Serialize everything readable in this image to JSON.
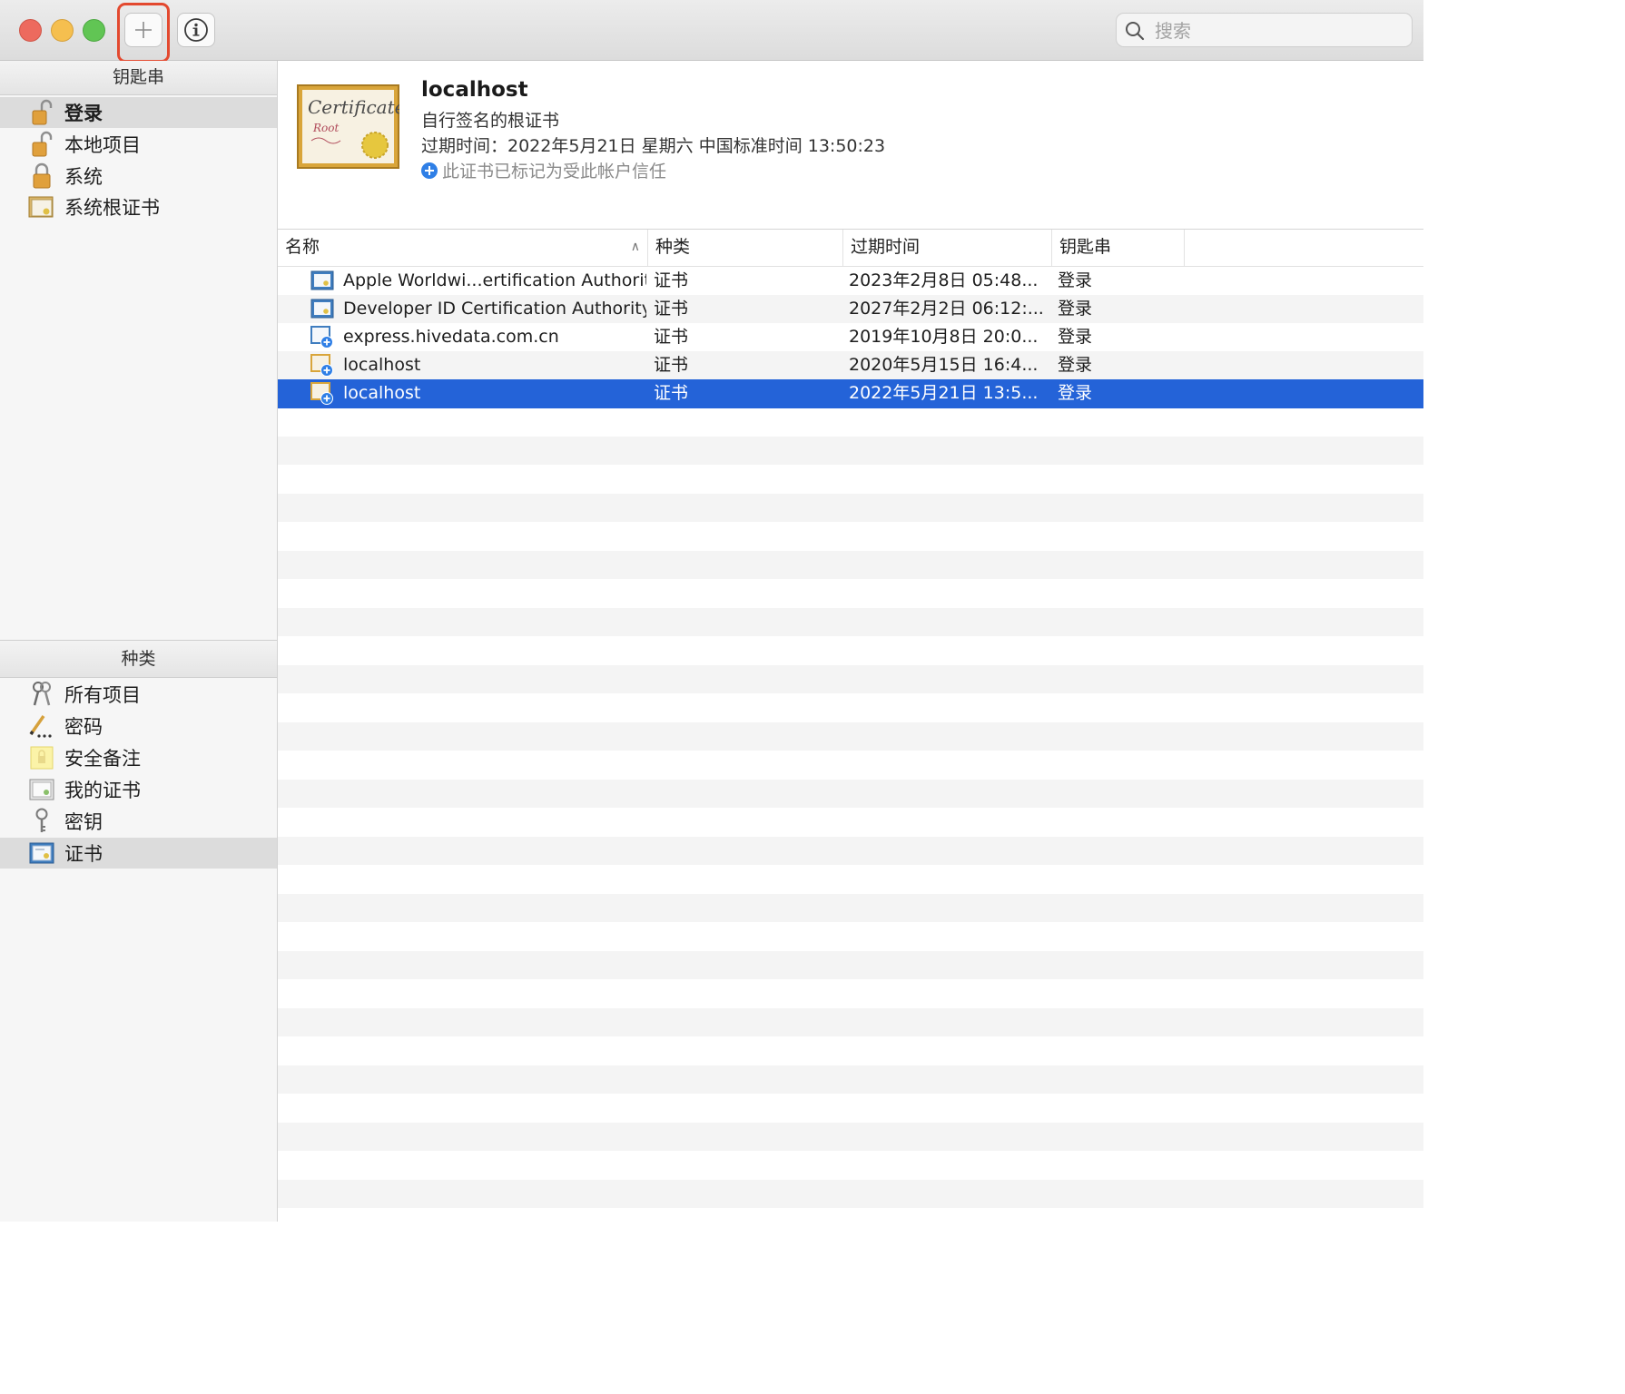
{
  "toolbar": {
    "search_placeholder": "搜索"
  },
  "sidebar": {
    "keychains_header": "钥匙串",
    "keychains": [
      {
        "label": "登录"
      },
      {
        "label": "本地项目"
      },
      {
        "label": "系统"
      },
      {
        "label": "系统根证书"
      }
    ],
    "category_header": "种类",
    "categories": [
      {
        "label": "所有项目"
      },
      {
        "label": "密码"
      },
      {
        "label": "安全备注"
      },
      {
        "label": "我的证书"
      },
      {
        "label": "密钥"
      },
      {
        "label": "证书"
      }
    ]
  },
  "detail": {
    "title": "localhost",
    "subtitle": "自行签名的根证书",
    "expires": "过期时间：2022年5月21日 星期六 中国标准时间 13:50:23",
    "trust": "此证书已标记为受此帐户信任"
  },
  "table": {
    "headers": {
      "name": "名称",
      "kind": "种类",
      "expires": "过期时间",
      "keychain": "钥匙串"
    },
    "rows": [
      {
        "name": "Apple Worldwi...ertification Authority",
        "kind": "证书",
        "expires": "2023年2月8日 05:48...",
        "keychain": "登录"
      },
      {
        "name": "Developer ID Certification Authority",
        "kind": "证书",
        "expires": "2027年2月2日 06:12:...",
        "keychain": "登录"
      },
      {
        "name": "express.hivedata.com.cn",
        "kind": "证书",
        "expires": "2019年10月8日 20:0...",
        "keychain": "登录"
      },
      {
        "name": "localhost",
        "kind": "证书",
        "expires": "2020年5月15日 16:4...",
        "keychain": "登录"
      },
      {
        "name": "localhost",
        "kind": "证书",
        "expires": "2022年5月21日 13:5...",
        "keychain": "登录"
      }
    ]
  }
}
